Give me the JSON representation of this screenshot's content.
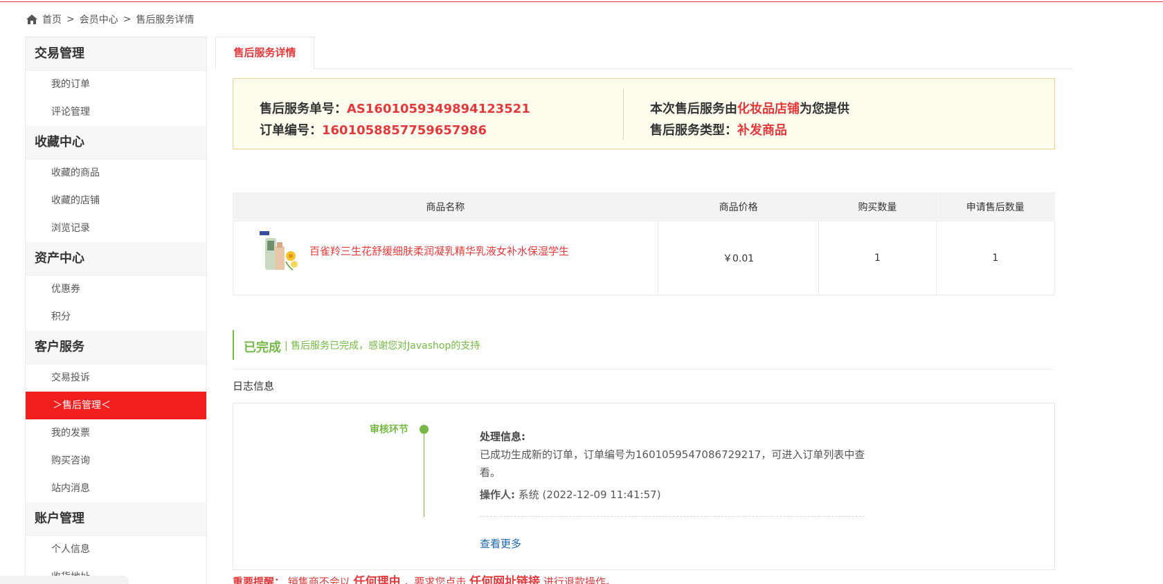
{
  "breadcrumb": {
    "home": "首页",
    "sep1": ">",
    "member": "会员中心",
    "sep2": ">",
    "current": "售后服务详情"
  },
  "sidebar": {
    "groups": [
      {
        "title": "交易管理",
        "items": [
          "我的订单",
          "评论管理"
        ]
      },
      {
        "title": "收藏中心",
        "items": [
          "收藏的商品",
          "收藏的店铺",
          "浏览记录"
        ]
      },
      {
        "title": "资产中心",
        "items": [
          "优惠券",
          "积分"
        ]
      },
      {
        "title": "客户服务",
        "items": [
          "交易投诉",
          "＞售后管理＜",
          "我的发票",
          "购买咨询",
          "站内消息"
        ]
      },
      {
        "title": "账户管理",
        "items": [
          "个人信息",
          "收货地址"
        ]
      }
    ]
  },
  "tab": {
    "label": "售后服务详情"
  },
  "info": {
    "service_no_label": "售后服务单号：",
    "service_no": "AS1601059349894123521",
    "order_no_label": "订单编号：",
    "order_no": "1601058857759657986",
    "provider_prefix": "本次售后服务由",
    "provider": "化妆品店铺",
    "provider_suffix": "为您提供",
    "type_label": "售后服务类型：",
    "type": "补发商品"
  },
  "table": {
    "headers": [
      "商品名称",
      "商品价格",
      "购买数量",
      "申请售后数量"
    ],
    "rows": [
      {
        "name": "百雀羚三生花舒缓细肤柔润凝乳精华乳液女补水保湿学生",
        "price": "￥0.01",
        "qty": "1",
        "apply_qty": "1"
      }
    ]
  },
  "status": {
    "title": "已完成",
    "desc": "| 售后服务已完成，感谢您对Javashop的支持"
  },
  "log": {
    "title": "日志信息",
    "step": "审核环节",
    "content_label": "处理信息:",
    "content": "已成功生成新的订单，订单编号为1601059547086729217，可进入订单列表中查看。",
    "operator_label": "操作人:",
    "operator": "系统 (2022-12-09 11:41:57)",
    "more": "查看更多"
  },
  "notice": {
    "label": "重要提醒：",
    "part1": "销售商不会以",
    "em1": "任何理由",
    "part2": "，要求您点击",
    "em2": "任何网址链接",
    "part3": "进行退款操作。"
  },
  "colors": {
    "accent": "#e4393c",
    "success": "#76b846",
    "link": "#1b66b3"
  }
}
